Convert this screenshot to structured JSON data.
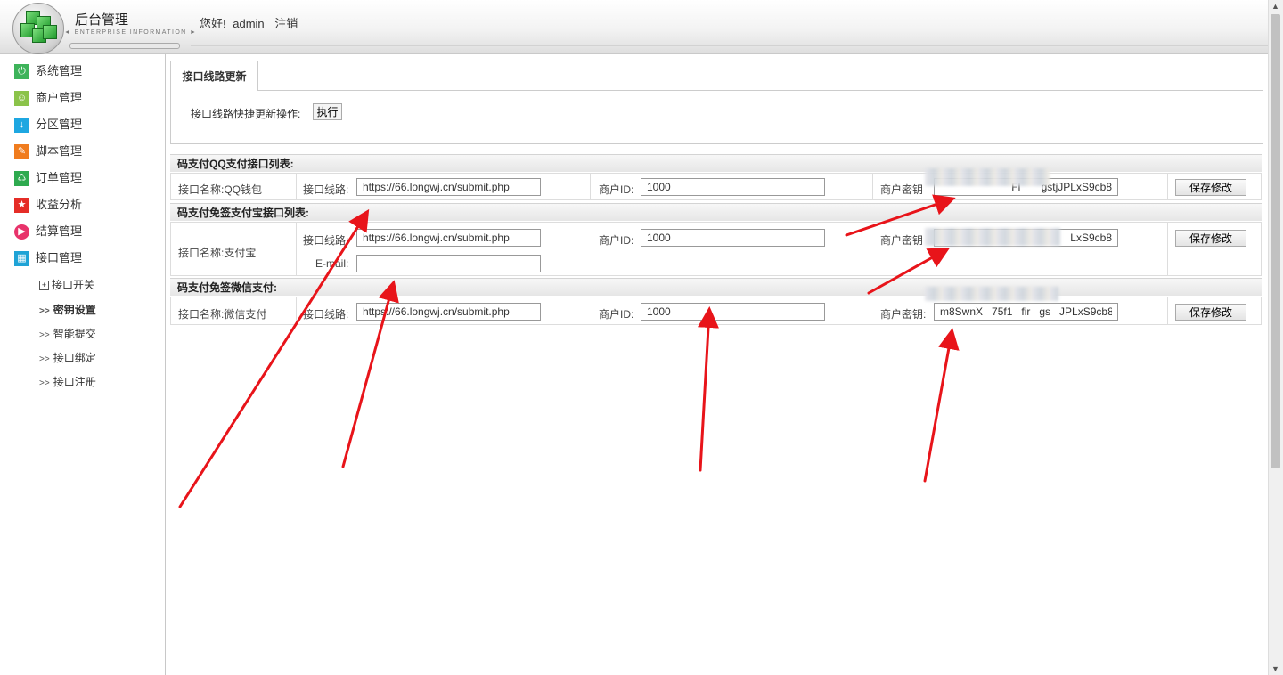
{
  "header": {
    "title": "后台管理",
    "subtitle": "◄ ENTERPRISE INFORMATION ►",
    "greeting": "您好!",
    "username": "admin",
    "logout": "注销"
  },
  "sidebar": {
    "items": [
      {
        "label": "系统管理",
        "icon": "power-icon",
        "color": "#3db35a"
      },
      {
        "label": "商户管理",
        "icon": "smile-icon",
        "color": "#8bc34a"
      },
      {
        "label": "分区管理",
        "icon": "download-icon",
        "color": "#1ea7e1"
      },
      {
        "label": "脚本管理",
        "icon": "pencil-icon",
        "color": "#f07c1e"
      },
      {
        "label": "订单管理",
        "icon": "recycle-icon",
        "color": "#2eaa4f"
      },
      {
        "label": "收益分析",
        "icon": "star-icon",
        "color": "#e52d27"
      },
      {
        "label": "结算管理",
        "icon": "play-icon",
        "color": "#e8336b"
      },
      {
        "label": "接口管理",
        "icon": "grid-icon",
        "color": "#1fa3d6"
      }
    ],
    "sub_items": [
      {
        "label": "接口开关",
        "prefix": "+"
      },
      {
        "label": "密钥设置",
        "prefix": ">>"
      },
      {
        "label": "智能提交",
        "prefix": ">>"
      },
      {
        "label": "接口绑定",
        "prefix": ">>"
      },
      {
        "label": "接口注册",
        "prefix": ">>"
      }
    ]
  },
  "panel": {
    "tab": "接口线路更新",
    "quick_label": "接口线路快捷更新操作:",
    "exec_button": "执行"
  },
  "sections": [
    {
      "title": "码支付QQ支付接口列表:",
      "name_label": "接口名称:QQ钱包",
      "route_label": "接口线路:",
      "route_value": "https://66.longwj.cn/submit.php",
      "merchant_label": "商户ID:",
      "merchant_value": "1000",
      "key_label": "商户密钥",
      "key_value": "                     Fl       gstjJPLxS9cb8",
      "save": "保存修改"
    },
    {
      "title": "码支付免签支付宝接口列表:",
      "name_label": "接口名称:支付宝",
      "route_label": "接口线路:",
      "route_value": "https://66.longwj.cn/submit.php",
      "merchant_label": "商户ID:",
      "merchant_value": "1000",
      "key_label": "商户密钥",
      "key_value": "                                LxS9cb8",
      "email_label": "E-mail:",
      "email_value": "",
      "save": "保存修改"
    },
    {
      "title": "码支付免签微信支付:",
      "name_label": "接口名称:微信支付",
      "route_label": "接口线路:",
      "route_value": "https://66.longwj.cn/submit.php",
      "merchant_label": "商户ID:",
      "merchant_value": "1000",
      "key_label": "商户密钥:",
      "key_value": "m8SwnX   75f1   fir   gs   JPLxS9cb8",
      "save": "保存修改"
    }
  ],
  "annotation_color": "#e8141a"
}
